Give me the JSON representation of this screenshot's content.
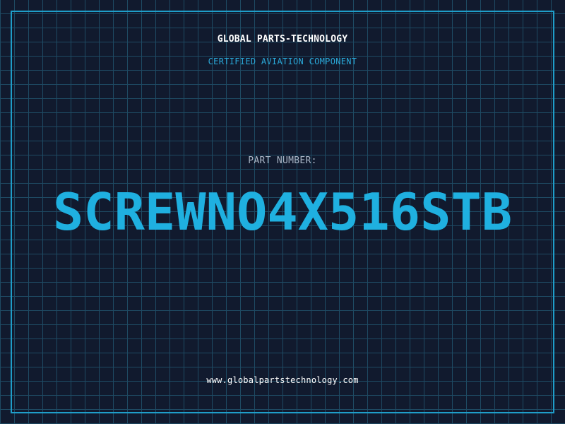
{
  "header": {
    "company": "GLOBAL PARTS-TECHNOLOGY",
    "subtitle": "CERTIFIED AVIATION COMPONENT"
  },
  "part": {
    "label": "PART NUMBER:",
    "number": "SCREWNO4X516STB"
  },
  "footer": {
    "website": "www.globalpartstechnology.com"
  },
  "colors": {
    "background": "#111a2e",
    "grid": "#1e4a63",
    "frame": "#1f9ec9",
    "accent": "#1fb0e0"
  }
}
